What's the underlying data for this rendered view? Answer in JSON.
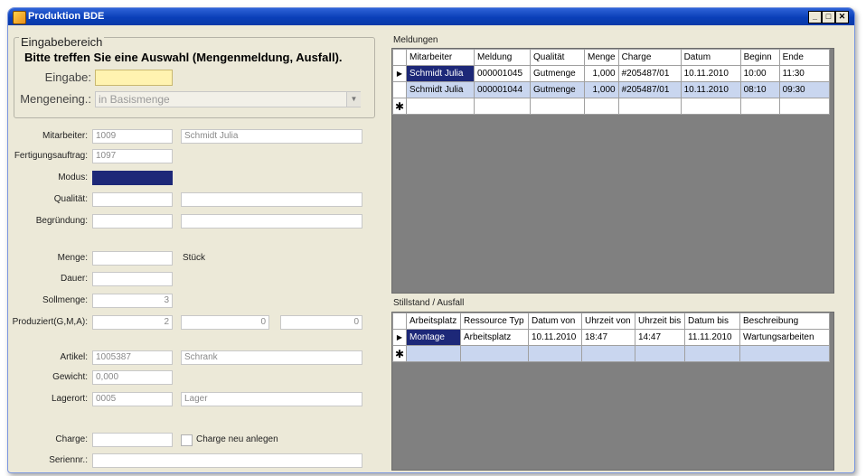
{
  "window": {
    "title": "Produktion BDE",
    "controls": [
      "_",
      "□",
      "✕"
    ]
  },
  "input_area": {
    "group_title": "Eingabebereich",
    "instruction": "Bitte treffen Sie eine Auswahl (Mengenmeldung, Ausfall).",
    "eingabe_label": "Eingabe:",
    "eingabe_value": "",
    "mengeneing_label": "Mengeneing.:",
    "mengeneing_value": "in Basismenge"
  },
  "form": {
    "mitarbeiter_label": "Mitarbeiter:",
    "mitarbeiter_id": "1009",
    "mitarbeiter_name": "Schmidt Julia",
    "fertigungsauftrag_label": "Fertigungsauftrag:",
    "fertigungsauftrag_value": "1097",
    "modus_label": "Modus:",
    "qualitaet_label": "Qualität:",
    "begruendung_label": "Begründung:",
    "menge_label": "Menge:",
    "menge_unit": "Stück",
    "dauer_label": "Dauer:",
    "sollmenge_label": "Sollmenge:",
    "sollmenge_value": "3",
    "produziert_label": "Produziert(G,M,A):",
    "produziert_g": "2",
    "produziert_m": "0",
    "produziert_a": "0",
    "artikel_label": "Artikel:",
    "artikel_id": "1005387",
    "artikel_name": "Schrank",
    "gewicht_label": "Gewicht:",
    "gewicht_value": "0,000",
    "lagerort_label": "Lagerort:",
    "lagerort_id": "0005",
    "lagerort_name": "Lager",
    "charge_label": "Charge:",
    "charge_neu_label": "Charge neu anlegen",
    "seriennr_label": "Seriennr.:"
  },
  "meldungen": {
    "title": "Meldungen",
    "columns": [
      "Mitarbeiter",
      "Meldung",
      "Qualität",
      "Menge",
      "Charge",
      "Datum",
      "Beginn",
      "Ende"
    ],
    "rows": [
      {
        "Mitarbeiter": "Schmidt Julia",
        "Meldung": "000001045",
        "Qualität": "Gutmenge",
        "Menge": "1,000",
        "Charge": "#205487/01",
        "Datum": "10.11.2010",
        "Beginn": "10:00",
        "Ende": "11:30"
      },
      {
        "Mitarbeiter": "Schmidt Julia",
        "Meldung": "000001044",
        "Qualität": "Gutmenge",
        "Menge": "1,000",
        "Charge": "#205487/01",
        "Datum": "10.11.2010",
        "Beginn": "08:10",
        "Ende": "09:30"
      }
    ]
  },
  "stillstand": {
    "title": "Stillstand / Ausfall",
    "columns": [
      "Arbeitsplatz",
      "Ressource Typ",
      "Datum von",
      "Uhrzeit von",
      "Uhrzeit bis",
      "Datum bis",
      "Beschreibung"
    ],
    "rows": [
      {
        "Arbeitsplatz": "Montage",
        "Ressource Typ": "Arbeitsplatz",
        "Datum von": "10.11.2010",
        "Uhrzeit von": "18:47",
        "Uhrzeit bis": "14:47",
        "Datum bis": "11.11.2010",
        "Beschreibung": "Wartungsarbeiten"
      }
    ]
  },
  "colors": {
    "title_bar": "#0a3fb8",
    "window_bg": "#ece9d8",
    "selected_cell": "#1d2878",
    "selected_row": "#c9d6ef",
    "eingabe_field": "#fff3b0",
    "grid_bg": "#808080"
  }
}
